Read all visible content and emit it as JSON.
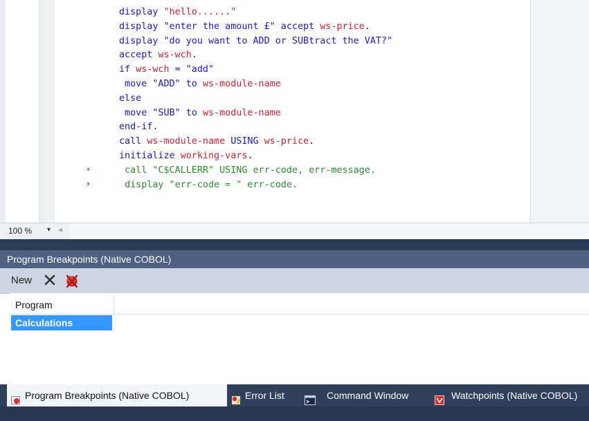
{
  "editor": {
    "lines": [
      {
        "tokens": [
          {
            "t": "display ",
            "c": "kw"
          },
          {
            "t": "\"hello......\"",
            "c": "str"
          }
        ]
      },
      {
        "tokens": [
          {
            "t": "display ",
            "c": "kw"
          },
          {
            "t": "\"enter the amount £\"",
            "c": "kw"
          },
          {
            "t": " accept ",
            "c": "kw"
          },
          {
            "t": "ws-price",
            "c": "var"
          },
          {
            "t": ".",
            "c": "kw"
          }
        ]
      },
      {
        "tokens": [
          {
            "t": "display ",
            "c": "kw"
          },
          {
            "t": "\"do you want to ADD or SUBtract the VAT?\"",
            "c": "kw"
          }
        ]
      },
      {
        "tokens": [
          {
            "t": "accept ",
            "c": "kw"
          },
          {
            "t": "ws-wch",
            "c": "var"
          },
          {
            "t": ".",
            "c": "kw"
          }
        ]
      },
      {
        "tokens": [
          {
            "t": "if ",
            "c": "kw"
          },
          {
            "t": "ws-wch",
            "c": "var"
          },
          {
            "t": " = ",
            "c": "kw"
          },
          {
            "t": "\"add\"",
            "c": "kw"
          }
        ]
      },
      {
        "tokens": [
          {
            "t": " move ",
            "c": "kw"
          },
          {
            "t": "\"ADD\"",
            "c": "kw"
          },
          {
            "t": " to ",
            "c": "kw"
          },
          {
            "t": "ws-module-name",
            "c": "var"
          }
        ]
      },
      {
        "tokens": [
          {
            "t": "else",
            "c": "kw"
          }
        ]
      },
      {
        "tokens": [
          {
            "t": " move ",
            "c": "kw"
          },
          {
            "t": "\"SUB\"",
            "c": "kw"
          },
          {
            "t": " to ",
            "c": "kw"
          },
          {
            "t": "ws-module-name",
            "c": "var"
          }
        ]
      },
      {
        "tokens": [
          {
            "t": "end-if.",
            "c": "kw"
          }
        ]
      },
      {
        "tokens": [
          {
            "t": "call ",
            "c": "kw"
          },
          {
            "t": "ws-module-name",
            "c": "var"
          },
          {
            "t": " USING ",
            "c": "kw"
          },
          {
            "t": "ws-price",
            "c": "var"
          },
          {
            "t": ".",
            "c": "kw"
          }
        ]
      },
      {
        "tokens": [
          {
            "t": "initialize ",
            "c": "kw"
          },
          {
            "t": "working-vars",
            "c": "var"
          },
          {
            "t": ".",
            "c": "kw"
          }
        ]
      },
      {
        "tokens": [
          {
            "t": " call \"C$CALLERR\" USING err-code, err-message.",
            "c": "cm"
          }
        ],
        "comment": true
      },
      {
        "tokens": [
          {
            "t": " display \"err-code = \" err-code.",
            "c": "cm"
          }
        ],
        "comment": true
      }
    ],
    "comment_marker": "*"
  },
  "zoom": {
    "value": "100 %",
    "arrow": "▾"
  },
  "tool_window": {
    "title": "Program Breakpoints (Native COBOL)",
    "toolbar": {
      "new_label": "New"
    },
    "grid": {
      "columns": [
        "Program"
      ],
      "rows": [
        [
          "Calculations"
        ]
      ]
    }
  },
  "tabs": [
    {
      "label": "Program Breakpoints (Native COBOL)",
      "active": true,
      "icon": "breakpoint-icon"
    },
    {
      "label": "Error List",
      "active": false,
      "icon": "error-list-icon"
    },
    {
      "label": "Command Window",
      "active": false,
      "icon": "command-window-icon"
    },
    {
      "label": "Watchpoints (Native COBOL)",
      "active": false,
      "icon": "watchpoint-icon"
    }
  ],
  "colors": {
    "keyword": "#1a1acc",
    "string": "#cc2233",
    "comment": "#2e8b2e",
    "selection": "#3399ff",
    "tool_title": "#4f6180"
  }
}
